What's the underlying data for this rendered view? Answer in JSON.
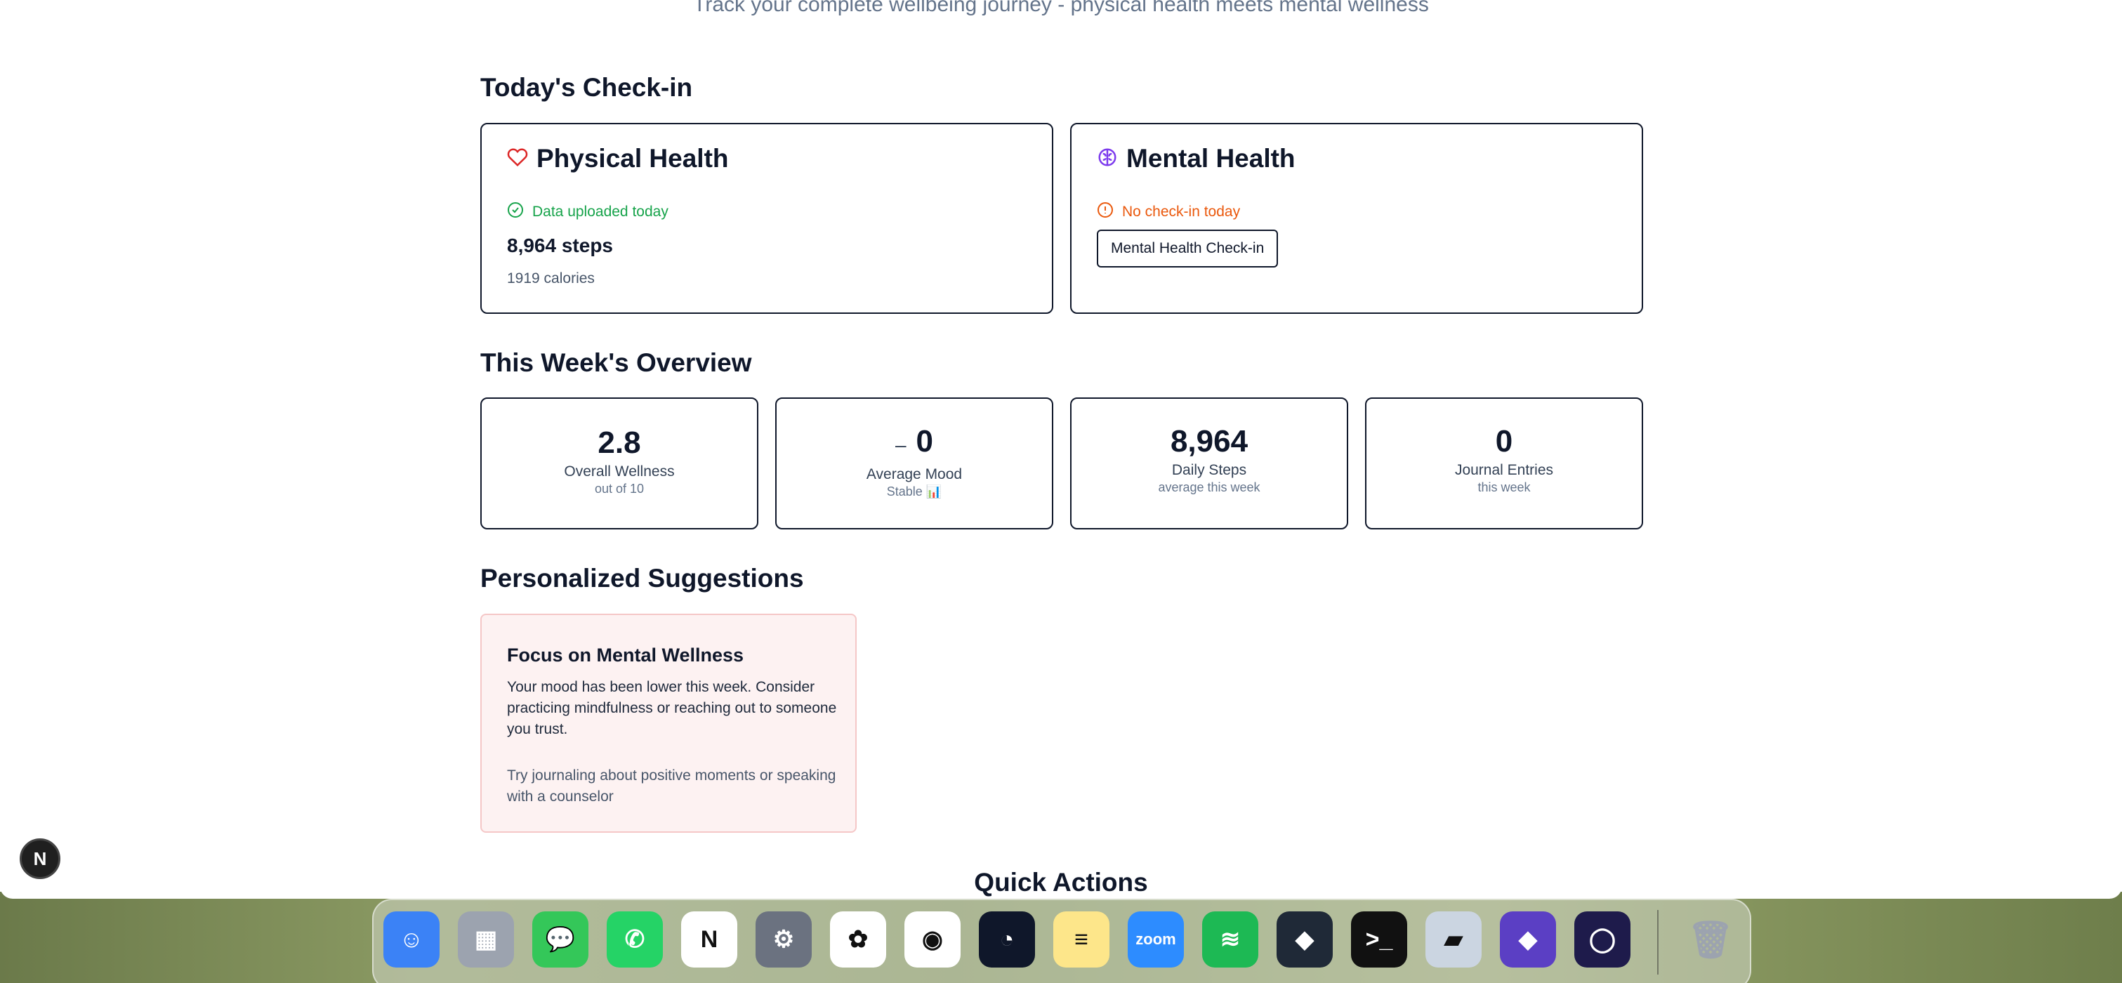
{
  "header": {
    "subtitle": "Track your complete wellbeing journey - physical health meets mental wellness"
  },
  "checkin": {
    "title": "Today's Check-in",
    "physical": {
      "title": "Physical Health",
      "status": "Data uploaded today",
      "steps": "8,964 steps",
      "calories": "1919 calories"
    },
    "mental": {
      "title": "Mental Health",
      "status": "No check-in today",
      "button": "Mental Health Check-in"
    }
  },
  "overview": {
    "title": "This Week's Overview",
    "stats": [
      {
        "value": "2.8",
        "label": "Overall Wellness",
        "sub": "out of 10"
      },
      {
        "prefix": "–",
        "value": "0",
        "label": "Average Mood",
        "sub": "Stable 📊"
      },
      {
        "value": "8,964",
        "label": "Daily Steps",
        "sub": "average this week"
      },
      {
        "value": "0",
        "label": "Journal Entries",
        "sub": "this week"
      }
    ]
  },
  "suggestions": {
    "title": "Personalized Suggestions",
    "items": [
      {
        "heading": "Focus on Mental Wellness",
        "body": "Your mood has been lower this week. Consider practicing mindfulness or reaching out to someone you trust.",
        "tip": "Try journaling about positive moments or speaking with a counselor"
      }
    ]
  },
  "quick_actions": {
    "title": "Quick Actions"
  },
  "nextjs_badge": "N",
  "dock": {
    "apps": [
      {
        "name": "finder-icon",
        "glyph": "☺",
        "color": "#3b82f6"
      },
      {
        "name": "launchpad-icon",
        "glyph": "▦",
        "color": "#9ca3af"
      },
      {
        "name": "messages-icon",
        "glyph": "💬",
        "color": "#34c759"
      },
      {
        "name": "whatsapp-icon",
        "glyph": "✆",
        "color": "#25d366"
      },
      {
        "name": "notion-icon",
        "glyph": "N",
        "color": "#ffffff"
      },
      {
        "name": "system-settings-icon",
        "glyph": "⚙",
        "color": "#6b7280"
      },
      {
        "name": "photos-icon",
        "glyph": "✿",
        "color": "#ffffff"
      },
      {
        "name": "chrome-icon",
        "glyph": "◉",
        "color": "#ffffff"
      },
      {
        "name": "app-icon",
        "glyph": "◔",
        "color": "#0f172a"
      },
      {
        "name": "notes-icon",
        "glyph": "≡",
        "color": "#fde68a"
      },
      {
        "name": "zoom-icon",
        "glyph": "zoom",
        "color": "#2d8cff"
      },
      {
        "name": "spotify-icon",
        "glyph": "≋",
        "color": "#1db954"
      },
      {
        "name": "app-icon",
        "glyph": "◆",
        "color": "#1f2937"
      },
      {
        "name": "terminal-icon",
        "glyph": ">_",
        "color": "#111111"
      },
      {
        "name": "app-icon",
        "glyph": "▰",
        "color": "#cbd5e1"
      },
      {
        "name": "obsidian-icon",
        "glyph": "◆",
        "color": "#5b3fc4"
      },
      {
        "name": "app-icon",
        "glyph": "◯",
        "color": "#1e1b4b"
      }
    ],
    "trash": {
      "name": "trash-icon",
      "glyph": "🗑",
      "color": "#e5e7eb"
    }
  }
}
